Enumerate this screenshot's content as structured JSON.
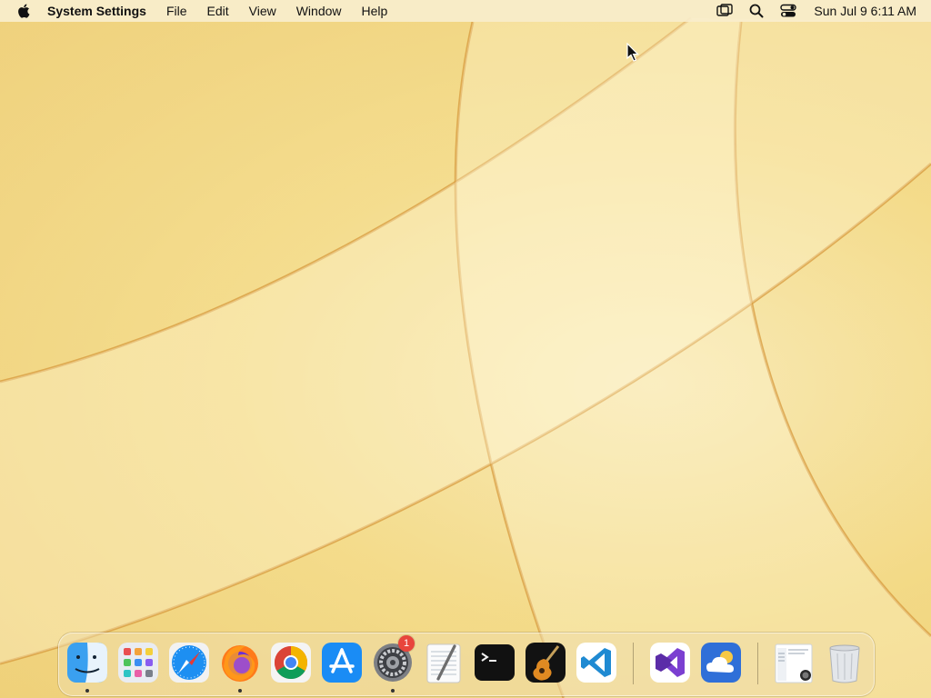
{
  "menubar": {
    "app_name": "System Settings",
    "items": [
      "File",
      "Edit",
      "View",
      "Window",
      "Help"
    ],
    "clock": "Sun Jul 9  6:11 AM"
  },
  "dock": {
    "apps": [
      {
        "name": "Finder",
        "icon": "finder-icon",
        "running": true
      },
      {
        "name": "Launchpad",
        "icon": "launchpad-icon",
        "running": false
      },
      {
        "name": "Safari",
        "icon": "safari-icon",
        "running": false
      },
      {
        "name": "Firefox",
        "icon": "firefox-icon",
        "running": true
      },
      {
        "name": "Google Chrome",
        "icon": "chrome-icon",
        "running": false
      },
      {
        "name": "App Store",
        "icon": "app-store-icon",
        "running": false
      },
      {
        "name": "System Settings",
        "icon": "system-settings-icon",
        "running": true,
        "badge": "1"
      },
      {
        "name": "TextEdit",
        "icon": "textedit-icon",
        "running": false
      },
      {
        "name": "Terminal",
        "icon": "terminal-icon",
        "running": false
      },
      {
        "name": "GarageBand",
        "icon": "garageband-icon",
        "running": false
      },
      {
        "name": "Visual Studio Code",
        "icon": "vscode-icon",
        "running": false
      },
      {
        "name": "Visual Studio",
        "icon": "visual-studio-icon",
        "running": false
      },
      {
        "name": "Weather",
        "icon": "weather-icon",
        "running": false
      },
      {
        "name": "Downloads",
        "icon": "downloads-stack-icon",
        "running": false
      },
      {
        "name": "Trash",
        "icon": "trash-icon",
        "running": false
      }
    ]
  },
  "colors": {
    "wallpaper_light": "#fbf2cf",
    "wallpaper_dark": "#ebc76a",
    "badge_red": "#e8453c"
  }
}
